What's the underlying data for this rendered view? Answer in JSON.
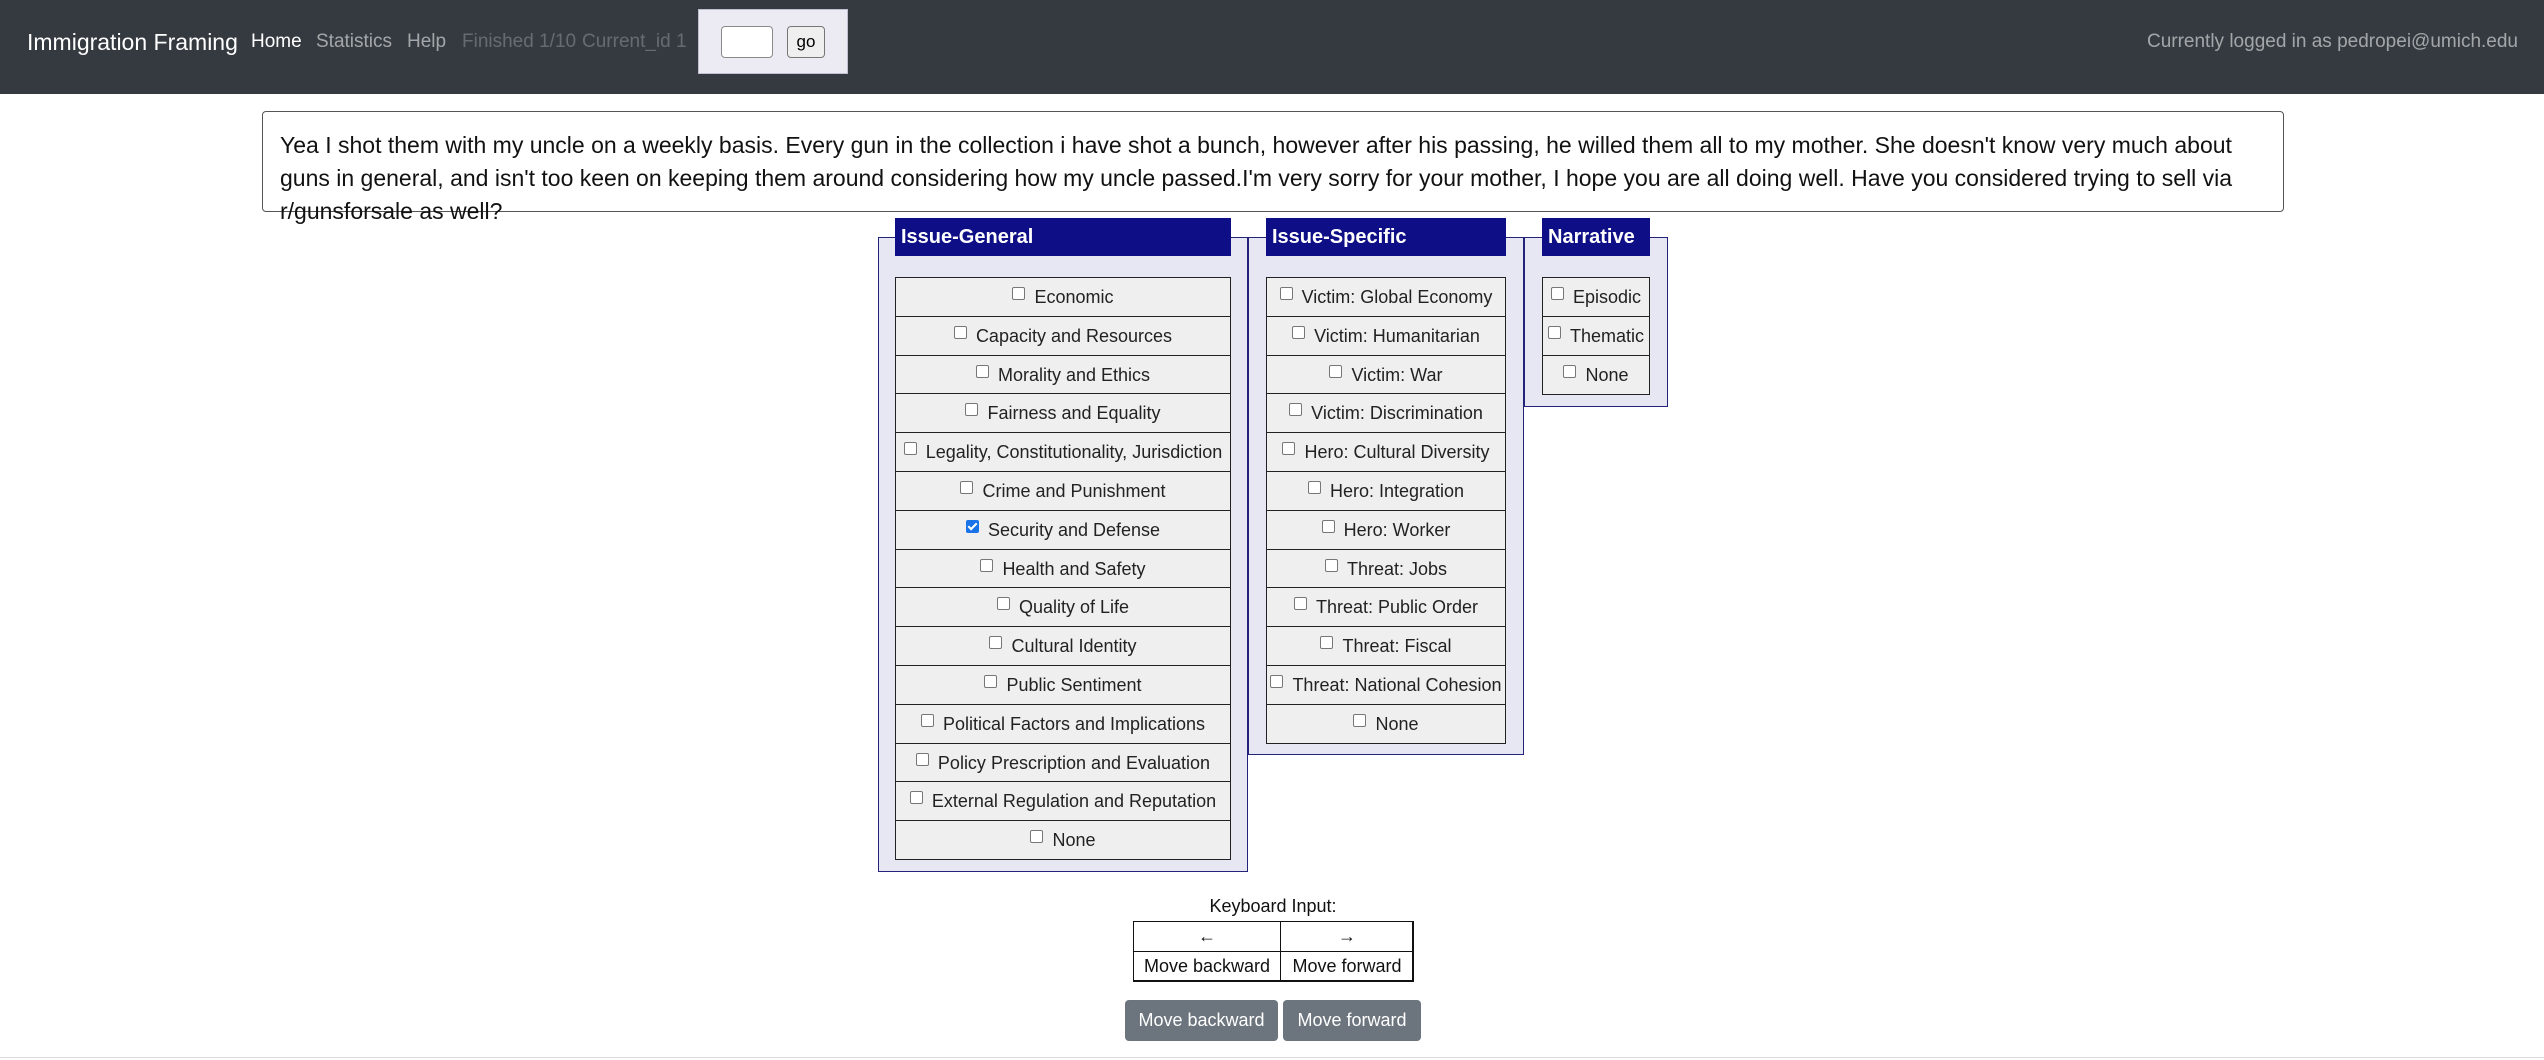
{
  "navbar": {
    "brand": "Immigration Framing",
    "links": [
      {
        "label": "Home",
        "state": "active"
      },
      {
        "label": "Statistics",
        "state": "normal"
      },
      {
        "label": "Help",
        "state": "normal"
      },
      {
        "label": "Finished 1/10",
        "state": "disabled"
      },
      {
        "label": "Current_id 1",
        "state": "disabled"
      }
    ],
    "jump": {
      "input_value": "",
      "button_label": "go"
    },
    "login_text": "Currently logged in as pedropei@umich.edu"
  },
  "text_content": "Yea I shot them with my uncle on a weekly basis. Every gun in the collection i have shot a bunch, however after his passing, he willed them all to my mother. She doesn't know very much about guns in general, and isn't too keen on keeping them around considering how my uncle passed.I'm very sorry for your mother, I hope you are all doing well. Have you considered trying to sell via r/gunsforsale as well?",
  "panels": {
    "issue_general": {
      "title": "Issue-General",
      "options": [
        {
          "label": "Economic",
          "checked": false
        },
        {
          "label": "Capacity and Resources",
          "checked": false
        },
        {
          "label": "Morality and Ethics",
          "checked": false
        },
        {
          "label": "Fairness and Equality",
          "checked": false
        },
        {
          "label": "Legality, Constitutionality, Jurisdiction",
          "checked": false
        },
        {
          "label": "Crime and Punishment",
          "checked": false
        },
        {
          "label": "Security and Defense",
          "checked": true
        },
        {
          "label": "Health and Safety",
          "checked": false
        },
        {
          "label": "Quality of Life",
          "checked": false
        },
        {
          "label": "Cultural Identity",
          "checked": false
        },
        {
          "label": "Public Sentiment",
          "checked": false
        },
        {
          "label": "Political Factors and Implications",
          "checked": false
        },
        {
          "label": "Policy Prescription and Evaluation",
          "checked": false
        },
        {
          "label": "External Regulation and Reputation",
          "checked": false
        },
        {
          "label": "None",
          "checked": false
        }
      ]
    },
    "issue_specific": {
      "title": "Issue-Specific",
      "options": [
        {
          "label": "Victim: Global Economy",
          "checked": false
        },
        {
          "label": "Victim: Humanitarian",
          "checked": false
        },
        {
          "label": "Victim: War",
          "checked": false
        },
        {
          "label": "Victim: Discrimination",
          "checked": false
        },
        {
          "label": "Hero: Cultural Diversity",
          "checked": false
        },
        {
          "label": "Hero: Integration",
          "checked": false
        },
        {
          "label": "Hero: Worker",
          "checked": false
        },
        {
          "label": "Threat: Jobs",
          "checked": false
        },
        {
          "label": "Threat: Public Order",
          "checked": false
        },
        {
          "label": "Threat: Fiscal",
          "checked": false
        },
        {
          "label": "Threat: National Cohesion",
          "checked": false
        },
        {
          "label": "None",
          "checked": false
        }
      ]
    },
    "narrative": {
      "title": "Narrative",
      "options": [
        {
          "label": "Episodic",
          "checked": false
        },
        {
          "label": "Thematic",
          "checked": false
        },
        {
          "label": "None",
          "checked": false
        }
      ]
    }
  },
  "keyboard": {
    "title": "Keyboard Input:",
    "keys": [
      {
        "key": "←",
        "action": "Move backward"
      },
      {
        "key": "→",
        "action": "Move forward"
      }
    ]
  },
  "buttons": {
    "backward": "Move backward",
    "forward": "Move forward"
  },
  "colors": {
    "navbar_bg": "#343a40",
    "panel_header_bg": "#0e0e86",
    "panel_bg": "#e7e6f3",
    "button_bg": "#6c757d"
  }
}
